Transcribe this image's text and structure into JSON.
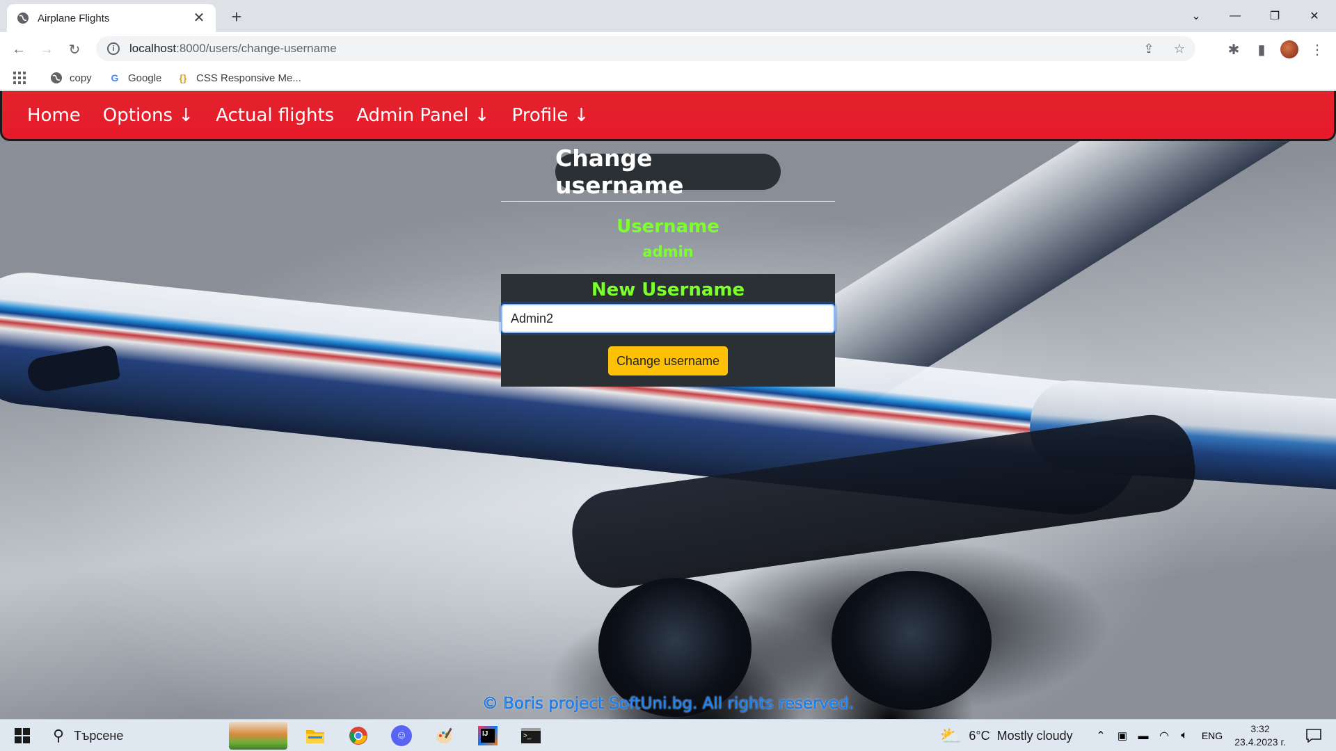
{
  "browser": {
    "tab_title": "Airplane Flights",
    "tab_close": "✕",
    "new_tab": "+",
    "url_host": "localhost",
    "url_path": ":8000/users/change-username",
    "bookmarks": [
      {
        "label": "copy",
        "icon": "globe-icon"
      },
      {
        "label": "Google",
        "icon": "google-icon"
      },
      {
        "label": "CSS Responsive Me...",
        "icon": "braces-icon"
      }
    ]
  },
  "nav": {
    "links": [
      "Home",
      "Options ↓",
      "Actual flights",
      "Admin Panel ↓",
      "Profile ↓"
    ],
    "color": "#e8192b"
  },
  "page": {
    "title": "Change username",
    "current_label": "Username",
    "current_value": "admin",
    "new_label": "New Username",
    "input_value": "Admin2",
    "submit_label": "Change username",
    "footer": "© Boris project SoftUni.bg. All rights reserved.",
    "accent_green": "#7cff2c",
    "button_color": "#ffc107"
  },
  "taskbar": {
    "search_placeholder": "Търсене",
    "weather_temp": "6°C",
    "weather_desc": "Mostly cloudy",
    "lang": "ENG",
    "time": "3:32",
    "date": "23.4.2023 г."
  }
}
